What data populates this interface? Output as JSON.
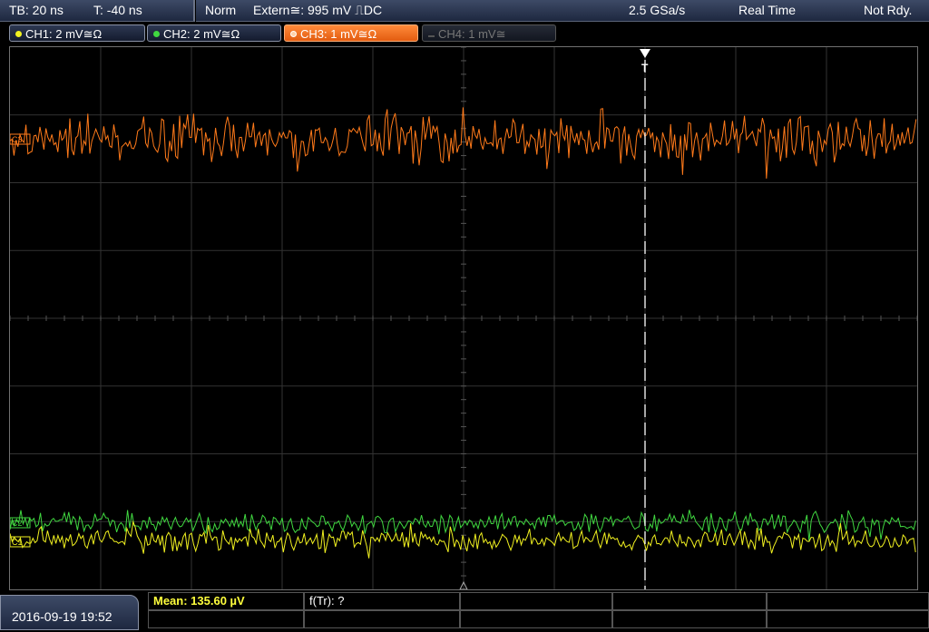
{
  "status_bar": {
    "timebase": "TB: 20 ns",
    "trigger_time": "T: -40 ns",
    "trigger_mode": "Norm",
    "trigger_source": "Extern≅: 995 mV ⎍DC",
    "sample_rate": "2.5 GSa/s",
    "acquisition_mode": "Real Time",
    "status": "Not Rdy."
  },
  "channels": [
    {
      "label": "CH1: 2 mV≅Ω",
      "color": "#f0f020",
      "state": "on"
    },
    {
      "label": "CH2: 2 mV≅Ω",
      "color": "#40d840",
      "state": "on"
    },
    {
      "label": "CH3: 1 mV≅Ω",
      "color": "#ff7a1a",
      "state": "active"
    },
    {
      "label": "CH4: 1 mV≅",
      "color": "#777777",
      "state": "off"
    }
  ],
  "markers": {
    "trigger_marker": "T",
    "ch3_marker": "C3",
    "ch2_marker": "C2",
    "ch1_marker": "C1"
  },
  "bottom": {
    "datetime": "2016-09-19 19:52",
    "measurement_1": "Mean: 135.60 µV",
    "measurement_2": "f(Tr): ?"
  },
  "colors": {
    "ch1": "#f0f020",
    "ch2": "#40d840",
    "ch3": "#ff7a1a",
    "grid": "#3a3a3a"
  }
}
